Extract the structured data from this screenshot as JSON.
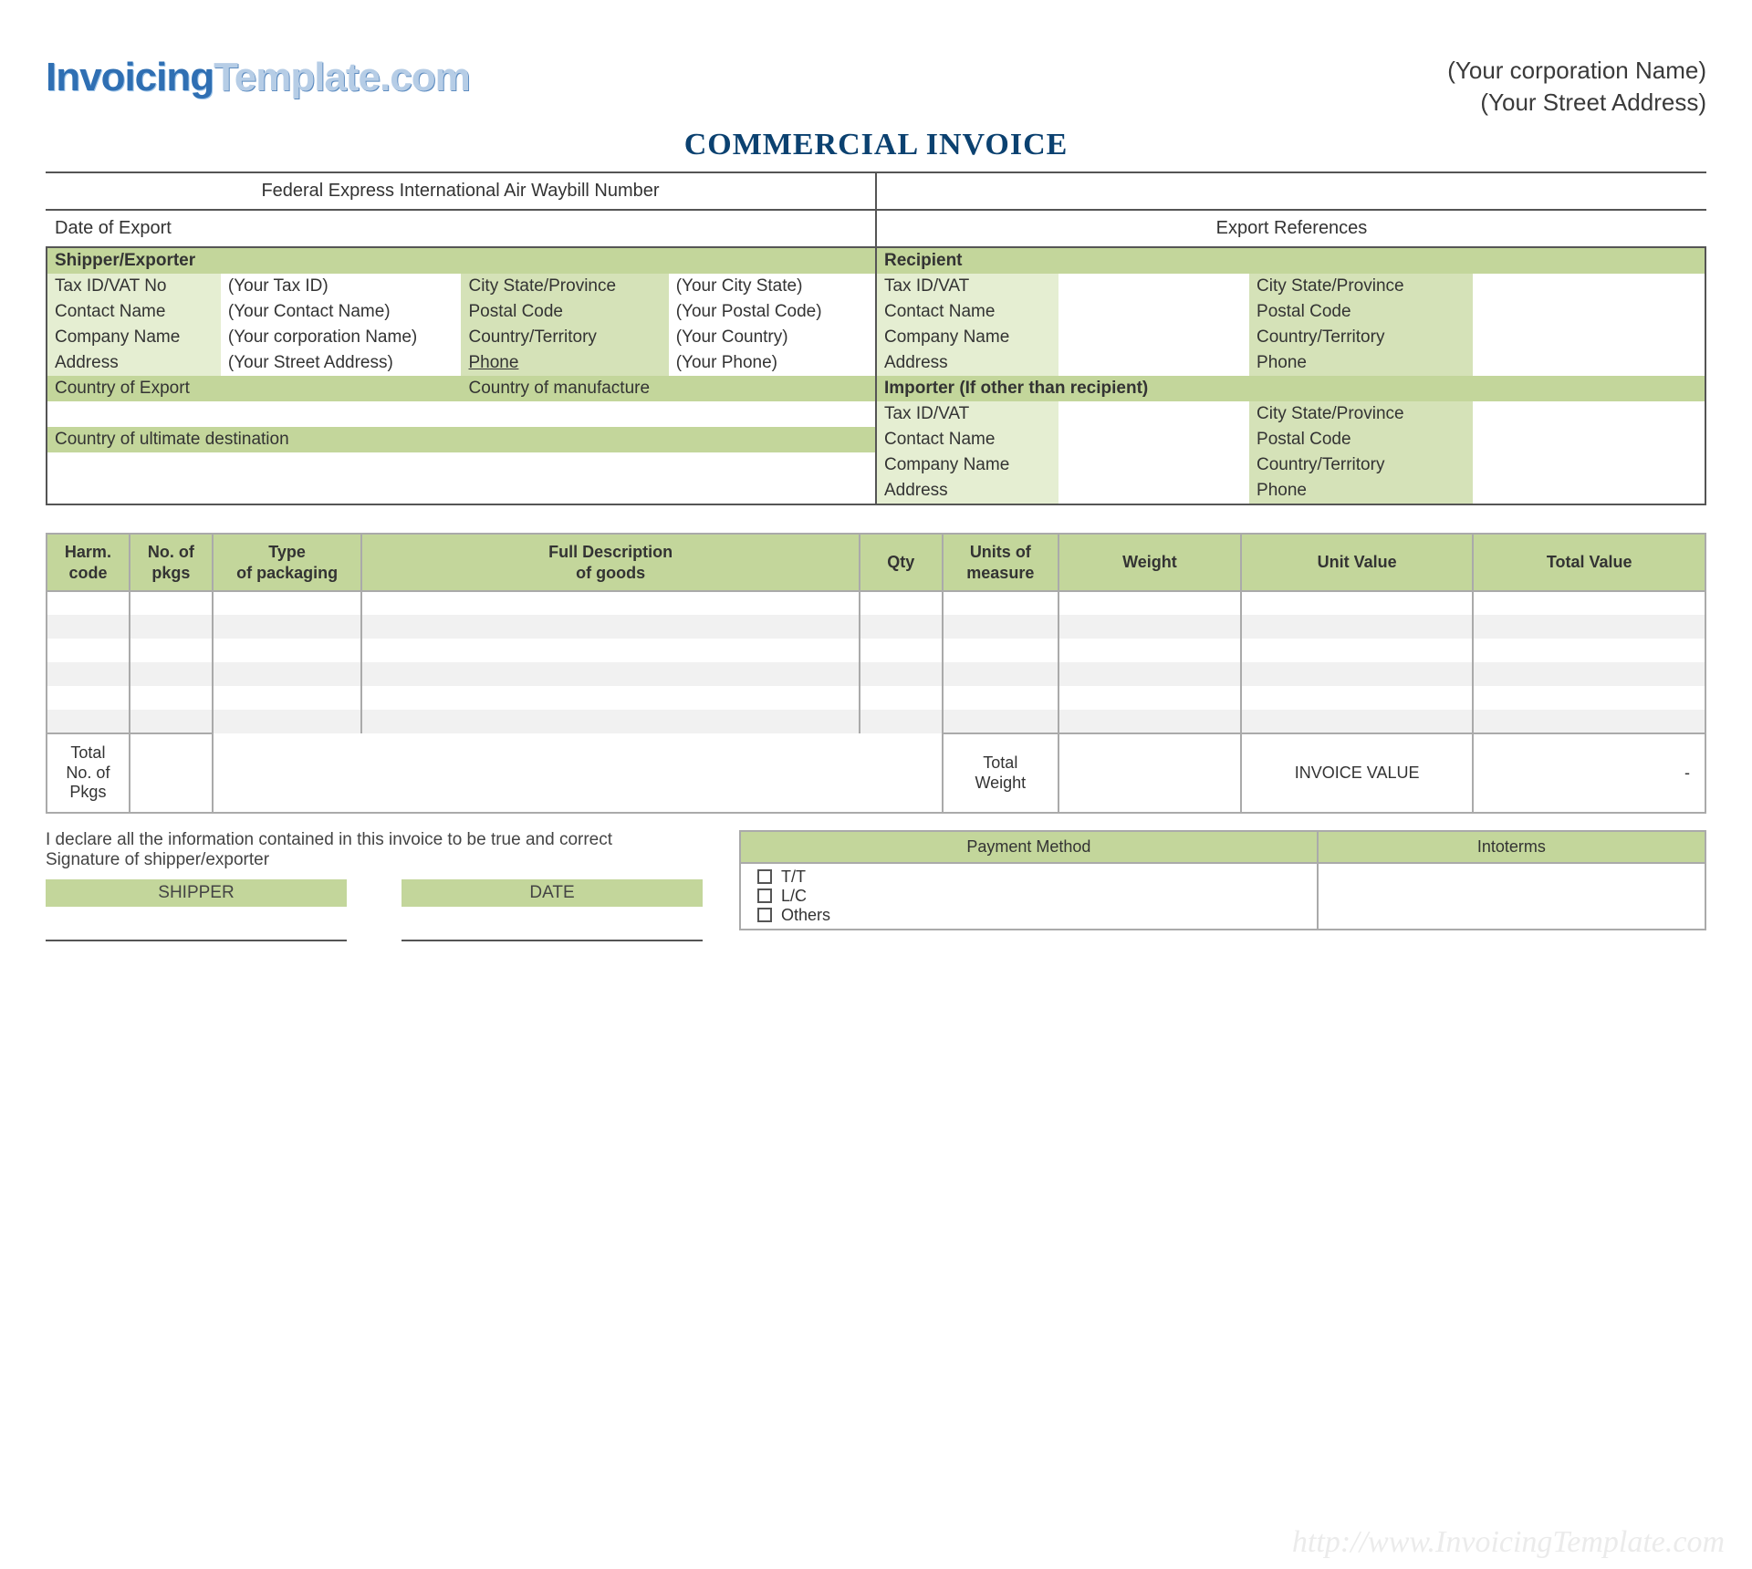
{
  "logo": {
    "part1": "Invoicing",
    "part2": "Template.com"
  },
  "corp": {
    "name": "(Your corporation  Name)",
    "addr": "(Your Street Address)"
  },
  "title": "COMMERCIAL INVOICE",
  "meta": {
    "waybill_label": "Federal Express International Air Waybill Number",
    "date_export_label": "Date of Export",
    "export_ref_label": "Export References"
  },
  "shipper": {
    "heading": "Shipper/Exporter",
    "tax_lbl": "Tax ID/VAT No",
    "tax_val": "(Your Tax ID)",
    "city_lbl": "City  State/Province",
    "city_val": "(Your City State)",
    "contact_lbl": "Contact Name",
    "contact_val": "(Your Contact Name)",
    "postal_lbl": "Postal Code",
    "postal_val": "(Your Postal Code)",
    "company_lbl": "Company Name",
    "company_val": "(Your corporation  Name)",
    "country_lbl": "Country/Territory",
    "country_val": "(Your Country)",
    "address_lbl": "Address",
    "address_val": "(Your Street Address)",
    "phone_lbl": "Phone",
    "phone_val": "(Your Phone)",
    "coe_lbl": "Country of Export",
    "com_lbl": "Country of manufacture",
    "cud_lbl": "Country of ultimate destination"
  },
  "recipient": {
    "heading": "Recipient",
    "tax_lbl": "Tax ID/VAT",
    "city_lbl": "City  State/Province",
    "contact_lbl": "Contact Name",
    "postal_lbl": "Postal Code",
    "company_lbl": "Company Name",
    "country_lbl": "Country/Territory",
    "address_lbl": "Address",
    "phone_lbl": "Phone"
  },
  "importer": {
    "heading": "Importer (If other than recipient)",
    "tax_lbl": "Tax ID/VAT",
    "city_lbl": "City  State/Province",
    "contact_lbl": "Contact Name",
    "postal_lbl": "Postal Code",
    "company_lbl": "Company Name",
    "country_lbl": "Country/Territory",
    "address_lbl": "Address",
    "phone_lbl": "Phone"
  },
  "items": {
    "h_harm": "Harm.\ncode",
    "h_pkgs": "No. of\npkgs",
    "h_type": "Type\nof packaging",
    "h_desc": "Full Description\nof goods",
    "h_qty": "Qty",
    "h_uom": "Units of\nmeasure",
    "h_weight": "Weight",
    "h_unitv": "Unit Value",
    "h_totalv": "Total Value",
    "f_total_pkgs": "Total\nNo. of\nPkgs",
    "f_total_weight": "Total\nWeight",
    "f_inv_value": "INVOICE VALUE",
    "f_dash": "-"
  },
  "declaration": {
    "line1": "I declare all the information contained in this invoice to be true and correct",
    "line2": "Signature of shipper/exporter",
    "shipper_lbl": "SHIPPER",
    "date_lbl": "DATE"
  },
  "payment": {
    "method_hdr": "Payment Method",
    "terms_hdr": "Intoterms",
    "opt_tt": "T/T",
    "opt_lc": "L/C",
    "opt_others": "Others"
  },
  "watermark": "http://www.InvoicingTemplate.com"
}
